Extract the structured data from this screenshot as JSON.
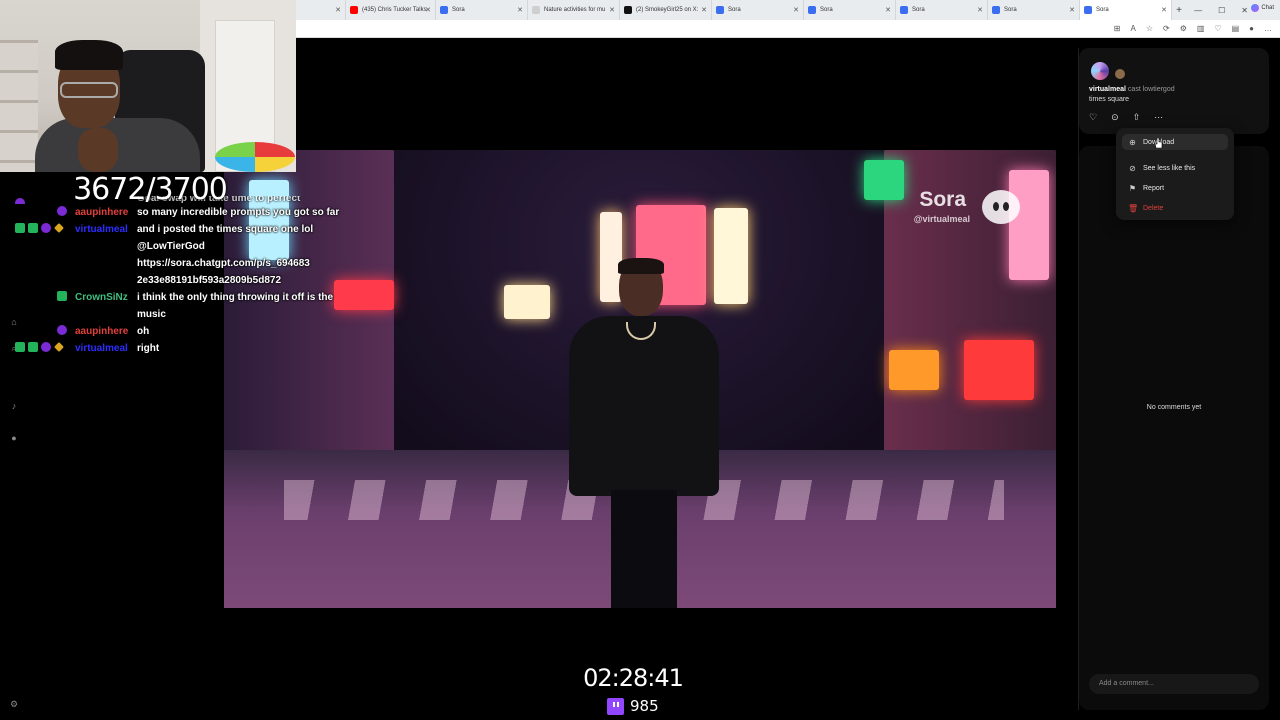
{
  "browser": {
    "tabs": [
      {
        "title": "(435) Chris Tucker Talks",
        "favicon_color": "#ff0000"
      },
      {
        "title": "Sora",
        "favicon_color": "#3a6df0"
      },
      {
        "title": "Nature activities for mu",
        "favicon_color": "#cfcfcf"
      },
      {
        "title": "(2) SmokeyGirl25 on X:",
        "favicon_color": "#111111"
      },
      {
        "title": "Sora",
        "favicon_color": "#3a6df0"
      },
      {
        "title": "Sora",
        "favicon_color": "#3a6df0"
      },
      {
        "title": "Sora",
        "favicon_color": "#3a6df0"
      },
      {
        "title": "Sora",
        "favicon_color": "#3a6df0"
      },
      {
        "title": "Sora",
        "favicon_color": "#3a6df0",
        "active": true
      }
    ],
    "chat_button_label": "Chat"
  },
  "overlay": {
    "sub_goal_counter": "3672/3700",
    "stream_timer": "02:28:41",
    "viewer_count": "985"
  },
  "chat": [
    {
      "user": "",
      "color": "#d14a4a",
      "text": "Goal swap will take time to perfect",
      "badges": [
        "purple"
      ],
      "cut": true
    },
    {
      "user": "aaupinhere",
      "color": "#e0413c",
      "text": "so many incredible prompts you got so far",
      "badges": [
        "purple"
      ]
    },
    {
      "user": "virtualmeal",
      "color": "#2d2dff",
      "text": "and i posted the times square one lol @LowTierGod https://sora.chatgpt.com/p/s_694683 2e33e88191bf593a2809b5d872",
      "badges": [
        "check",
        "check",
        "purple",
        "gold"
      ]
    },
    {
      "user": "CrownSiNz",
      "color": "#3fbf7f",
      "text": "i think the only thing throwing it off is the music",
      "badges": [
        "check"
      ]
    },
    {
      "user": "aaupinhere",
      "color": "#e0413c",
      "text": "oh",
      "badges": [
        "purple"
      ]
    },
    {
      "user": "virtualmeal",
      "color": "#2d2dff",
      "text": "right",
      "badges": [
        "check",
        "check",
        "purple",
        "gold"
      ]
    }
  ],
  "video": {
    "watermark": "Sora",
    "watermark_handle": "@virtualmeal"
  },
  "post": {
    "author": "virtualmeal",
    "cast_label": "cast lowtiergod",
    "caption": "times square",
    "no_comments_text": "No comments yet",
    "comment_placeholder": "Add a comment..."
  },
  "menu": {
    "items": [
      {
        "label": "Download",
        "icon": "download-icon"
      },
      {
        "label": "See less like this",
        "icon": "eye-off-icon"
      },
      {
        "label": "Report",
        "icon": "flag-icon"
      },
      {
        "label": "Delete",
        "icon": "trash-icon",
        "danger": true
      }
    ]
  }
}
